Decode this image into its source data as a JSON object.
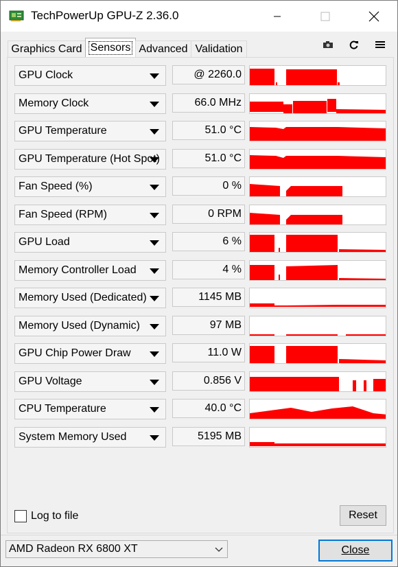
{
  "window": {
    "title": "TechPowerUp GPU-Z 2.36.0",
    "controls": {
      "minimize": "minimize-icon",
      "maximize": "maximize-icon",
      "close": "close-icon"
    }
  },
  "tabs": [
    {
      "label": "Graphics Card",
      "active": false
    },
    {
      "label": "Sensors",
      "active": true
    },
    {
      "label": "Advanced",
      "active": false
    },
    {
      "label": "Validation",
      "active": false
    }
  ],
  "toolbar": {
    "icons": [
      "camera-icon",
      "refresh-icon",
      "menu-icon"
    ]
  },
  "sensors": [
    {
      "name": "GPU Clock",
      "value": "@ 2260.0"
    },
    {
      "name": "Memory Clock",
      "value": "66.0 MHz"
    },
    {
      "name": "GPU Temperature",
      "value": "51.0 °C"
    },
    {
      "name": "GPU Temperature (Hot Spot)",
      "value": "51.0 °C"
    },
    {
      "name": "Fan Speed (%)",
      "value": "0 %"
    },
    {
      "name": "Fan Speed (RPM)",
      "value": "0 RPM"
    },
    {
      "name": "GPU Load",
      "value": "6 %"
    },
    {
      "name": "Memory Controller Load",
      "value": "4 %"
    },
    {
      "name": "Memory Used (Dedicated)",
      "value": "1145 MB"
    },
    {
      "name": "Memory Used (Dynamic)",
      "value": "97 MB"
    },
    {
      "name": "GPU Chip Power Draw",
      "value": "11.0 W"
    },
    {
      "name": "GPU Voltage",
      "value": "0.856 V"
    },
    {
      "name": "CPU Temperature",
      "value": "40.0 °C"
    },
    {
      "name": "System Memory Used",
      "value": "5195 MB"
    }
  ],
  "graph_color": "#ff0000",
  "log_to_file": {
    "label": "Log to file",
    "checked": false
  },
  "reset_label": "Reset",
  "gpu_select": {
    "selected": "AMD Radeon RX 6800 XT"
  },
  "close_label": "Close"
}
